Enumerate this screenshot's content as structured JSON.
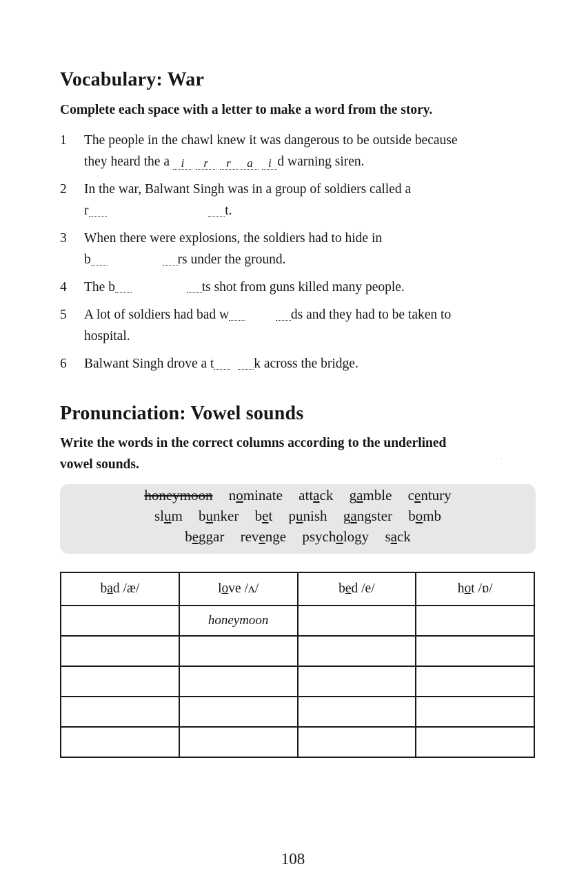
{
  "vocab": {
    "title": "Vocabulary: War",
    "instruction": "Complete each space with a letter to make a word from the story.",
    "items": [
      {
        "num": "1",
        "line1": "The people in the chawl knew it was dangerous to be outside because",
        "pre": "they heard the a",
        "letters": [
          "i",
          "r",
          "r",
          "a",
          "i"
        ],
        "post": "d warning siren."
      },
      {
        "num": "2",
        "line1": "In the war, Balwant Singh was in a group of soldiers called a",
        "first": "r",
        "last": "t."
      },
      {
        "num": "3",
        "line1": "When there were explosions, the soldiers had to hide in",
        "first": "b",
        "last": "rs under the ground."
      },
      {
        "num": "4",
        "pre": "The b",
        "post": "ts shot from guns killed many people."
      },
      {
        "num": "5",
        "pre": "A lot of soldiers had bad w",
        "post": "ds and they had to be taken to",
        "line2": "hospital."
      },
      {
        "num": "6",
        "pre": "Balwant Singh drove a t",
        "post": "k across the bridge."
      }
    ]
  },
  "pron": {
    "title": "Pronunciation: Vowel sounds",
    "instruction_line1": "Write the words in the correct columns according to the underlined",
    "instruction_line2": "vowel sounds.",
    "word_rows": [
      [
        {
          "text": "honeymoon",
          "struck": true
        },
        {
          "pre": "n",
          "u": "o",
          "post": "minate"
        },
        {
          "pre": "att",
          "u": "a",
          "post": "ck"
        },
        {
          "pre": "g",
          "u": "a",
          "post": "mble"
        },
        {
          "pre": "c",
          "u": "e",
          "post": "ntury"
        }
      ],
      [
        {
          "pre": "sl",
          "u": "u",
          "post": "m"
        },
        {
          "pre": "b",
          "u": "u",
          "post": "nker"
        },
        {
          "pre": "b",
          "u": "e",
          "post": "t"
        },
        {
          "pre": "p",
          "u": "u",
          "post": "nish"
        },
        {
          "pre": "g",
          "u": "a",
          "post": "ngster"
        },
        {
          "pre": "b",
          "u": "o",
          "post": "mb"
        }
      ],
      [
        {
          "pre": "b",
          "u": "e",
          "post": "ggar"
        },
        {
          "pre": "rev",
          "u": "e",
          "post": "nge"
        },
        {
          "pre": "psych",
          "u": "o",
          "post": "logy"
        },
        {
          "pre": "s",
          "u": "a",
          "post": "ck"
        }
      ]
    ],
    "columns": [
      {
        "pre": "b",
        "u": "a",
        "post": "d /æ/"
      },
      {
        "pre": "l",
        "u": "o",
        "post": "ve /ʌ/"
      },
      {
        "pre": "b",
        "u": "e",
        "post": "d /e/"
      },
      {
        "pre": "h",
        "u": "o",
        "post": "t /ɒ/"
      }
    ],
    "table_rows": [
      [
        "",
        "honeymoon",
        "",
        ""
      ],
      [
        "",
        "",
        "",
        ""
      ],
      [
        "",
        "",
        "",
        ""
      ],
      [
        "",
        "",
        "",
        ""
      ],
      [
        "",
        "",
        "",
        ""
      ]
    ]
  },
  "page_number": "108"
}
